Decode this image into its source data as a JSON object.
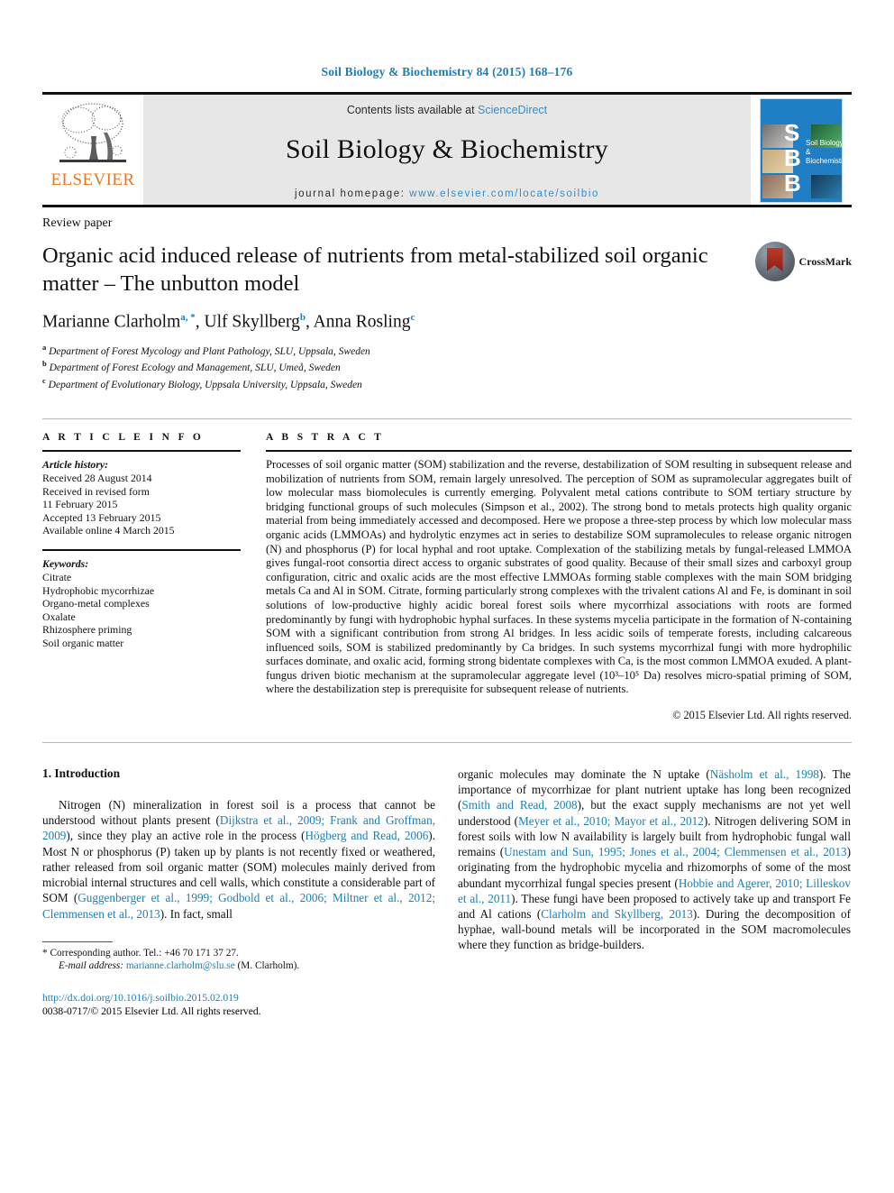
{
  "running_head": "Soil Biology & Biochemistry 84 (2015) 168–176",
  "masthead": {
    "contents_prefix": "Contents lists available at ",
    "sciencedirect": "ScienceDirect",
    "journal_title": "Soil Biology & Biochemistry",
    "homepage_prefix": "journal homepage: ",
    "homepage_url": "www.elsevier.com/locate/soilbio",
    "publisher_name": "ELSEVIER",
    "publisher_logo_icon": "elsevier-tree-icon",
    "cover_letters": [
      "S",
      "B",
      "B"
    ],
    "cover_title": "Soil Biology & Biochemistry",
    "accent_blue": "#1b7fb5",
    "cover_blue": "#1f7ec4",
    "elsevier_orange": "#E87722"
  },
  "article": {
    "type": "Review paper",
    "title": "Organic acid induced release of nutrients from metal-stabilized soil organic matter – The unbutton model",
    "crossmark_label": "CrossMark",
    "crossmark_icon": "crossmark-badge-icon",
    "authors": [
      {
        "name": "Marianne Clarholm",
        "marks": "a, *"
      },
      {
        "name": "Ulf Skyllberg",
        "marks": "b"
      },
      {
        "name": "Anna Rosling",
        "marks": "c"
      }
    ],
    "affiliations": [
      {
        "mark": "a",
        "text": "Department of Forest Mycology and Plant Pathology, SLU, Uppsala, Sweden"
      },
      {
        "mark": "b",
        "text": "Department of Forest Ecology and Management, SLU, Umeå, Sweden"
      },
      {
        "mark": "c",
        "text": "Department of Evolutionary Biology, Uppsala University, Uppsala, Sweden"
      }
    ]
  },
  "article_info": {
    "heading": "A R T I C L E  I N F O",
    "history_label": "Article history:",
    "history": [
      "Received 28 August 2014",
      "Received in revised form",
      "11 February 2015",
      "Accepted 13 February 2015",
      "Available online 4 March 2015"
    ],
    "keywords_label": "Keywords:",
    "keywords": [
      "Citrate",
      "Hydrophobic mycorrhizae",
      "Organo-metal complexes",
      "Oxalate",
      "Rhizosphere priming",
      "Soil organic matter"
    ]
  },
  "abstract": {
    "heading": "A B S T R A C T",
    "text": "Processes of soil organic matter (SOM) stabilization and the reverse, destabilization of SOM resulting in subsequent release and mobilization of nutrients from SOM, remain largely unresolved. The perception of SOM as supramolecular aggregates built of low molecular mass biomolecules is currently emerging. Polyvalent metal cations contribute to SOM tertiary structure by bridging functional groups of such molecules (Simpson et al., 2002). The strong bond to metals protects high quality organic material from being immediately accessed and decomposed. Here we propose a three-step process by which low molecular mass organic acids (LMMOAs) and hydrolytic enzymes act in series to destabilize SOM supramolecules to release organic nitrogen (N) and phosphorus (P) for local hyphal and root uptake. Complexation of the stabilizing metals by fungal-released LMMOA gives fungal-root consortia direct access to organic substrates of good quality. Because of their small sizes and carboxyl group configuration, citric and oxalic acids are the most effective LMMOAs forming stable complexes with the main SOM bridging metals Ca and Al in SOM. Citrate, forming particularly strong complexes with the trivalent cations Al and Fe, is dominant in soil solutions of low-productive highly acidic boreal forest soils where mycorrhizal associations with roots are formed predominantly by fungi with hydrophobic hyphal surfaces. In these systems mycelia participate in the formation of N-containing SOM with a significant contribution from strong Al bridges. In less acidic soils of temperate forests, including calcareous influenced soils, SOM is stabilized predominantly by Ca bridges. In such systems mycorrhizal fungi with more hydrophilic surfaces dominate, and oxalic acid, forming strong bidentate complexes with Ca, is the most common LMMOA exuded. A plant-fungus driven biotic mechanism at the supramolecular aggregate level (10³–10⁵ Da) resolves micro-spatial priming of SOM, where the destabilization step is prerequisite for subsequent release of nutrients.",
    "copyright": "© 2015 Elsevier Ltd. All rights reserved."
  },
  "introduction": {
    "heading": "1. Introduction",
    "left_paragraph_segments": [
      {
        "t": "Nitrogen (N) mineralization in forest soil is a process that cannot be understood without plants present (",
        "ref": false
      },
      {
        "t": "Dijkstra et al., 2009; Frank and Groffman, 2009",
        "ref": true
      },
      {
        "t": "), since they play an active role in the process (",
        "ref": false
      },
      {
        "t": "Högberg and Read, 2006",
        "ref": true
      },
      {
        "t": "). Most N or phosphorus (P) taken up by plants is not recently fixed or weathered, rather released from soil organic matter (SOM) molecules mainly derived from microbial internal structures and cell walls, which constitute a considerable part of SOM (",
        "ref": false
      },
      {
        "t": "Guggenberger et al., 1999; Godbold et al., 2006; Miltner et al., 2012; Clemmensen et al., 2013",
        "ref": true
      },
      {
        "t": "). In fact, small",
        "ref": false
      }
    ],
    "right_paragraph_segments": [
      {
        "t": "organic molecules may dominate the N uptake (",
        "ref": false
      },
      {
        "t": "Näsholm et al., 1998",
        "ref": true
      },
      {
        "t": "). The importance of mycorrhizae for plant nutrient uptake has long been recognized (",
        "ref": false
      },
      {
        "t": "Smith and Read, 2008",
        "ref": true
      },
      {
        "t": "), but the exact supply mechanisms are not yet well understood (",
        "ref": false
      },
      {
        "t": "Meyer et al., 2010; Mayor et al., 2012",
        "ref": true
      },
      {
        "t": "). Nitrogen delivering SOM in forest soils with low N availability is largely built from hydrophobic fungal wall remains (",
        "ref": false
      },
      {
        "t": "Unestam and Sun, 1995; Jones et al., 2004; Clemmensen et al., 2013",
        "ref": true
      },
      {
        "t": ") originating from the hydrophobic mycelia and rhizomorphs of some of the most abundant mycorrhizal fungal species present (",
        "ref": false
      },
      {
        "t": "Hobbie and Agerer, 2010; Lilleskov et al., 2011",
        "ref": true
      },
      {
        "t": "). These fungi have been proposed to actively take up and transport Fe and Al cations (",
        "ref": false
      },
      {
        "t": "Clarholm and Skyllberg, 2013",
        "ref": true
      },
      {
        "t": "). During the decomposition of hyphae, wall-bound metals will be incorporated in the SOM macromolecules where they function as bridge-builders.",
        "ref": false
      }
    ]
  },
  "footer": {
    "corresponding_marker": "*",
    "corresponding": "Corresponding author. Tel.: +46 70 171 37 27.",
    "email_label": "E-mail address:",
    "email": "marianne.clarholm@slu.se",
    "email_suffix": "(M. Clarholm).",
    "doi_url": "http://dx.doi.org/10.1016/j.soilbio.2015.02.019",
    "issn_line": "0038-0717/© 2015 Elsevier Ltd. All rights reserved."
  }
}
